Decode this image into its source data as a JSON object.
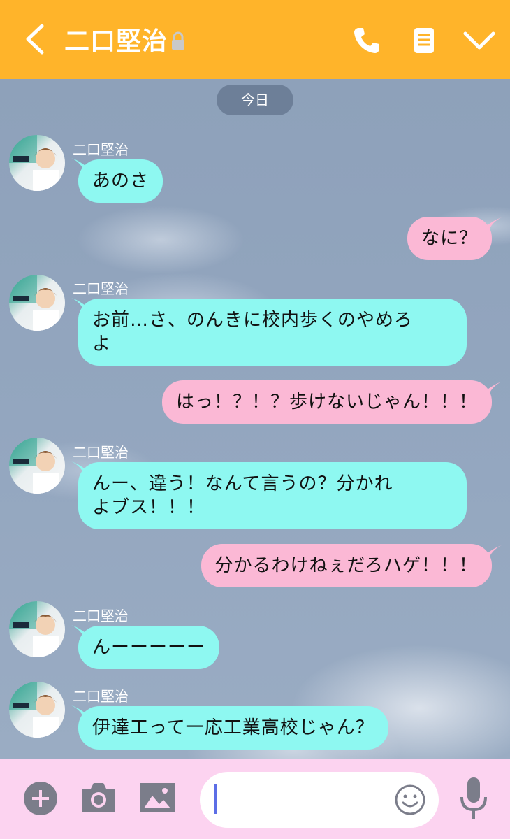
{
  "header": {
    "title": "二口堅治",
    "back_icon": "chevron-left-icon",
    "lock_icon": "lock-icon",
    "call_icon": "phone-icon",
    "notes_icon": "notes-icon",
    "menu_icon": "chevron-down-icon",
    "color": "#ffb42a"
  },
  "chat": {
    "date_label": "今日",
    "messages": [
      {
        "side": "in",
        "sender": "二口堅治",
        "text": "あのさ"
      },
      {
        "side": "out",
        "text": "なに？"
      },
      {
        "side": "in",
        "sender": "二口堅治",
        "lines": [
          "お前…さ、のんきに校内歩くのやめろ",
          "よ"
        ]
      },
      {
        "side": "out",
        "text": "はっ！？！？歩けないじゃん！！！"
      },
      {
        "side": "in",
        "sender": "二口堅治",
        "lines": [
          "んー、違う！なんて言うの？分かれ",
          "よブス！！！"
        ]
      },
      {
        "side": "out",
        "text": "分かるわけねぇだろハゲ！！！"
      },
      {
        "side": "in",
        "sender": "二口堅治",
        "text": "んーーーーー"
      },
      {
        "side": "in",
        "sender": "二口堅治",
        "text": "伊達工って一応工業高校じゃん？"
      }
    ],
    "incoming_color": "#8ef8f1",
    "outgoing_color": "#fbb8d5"
  },
  "footer": {
    "input_value": "",
    "plus_icon": "plus-circle-icon",
    "camera_icon": "camera-icon",
    "image_icon": "image-icon",
    "emoji_icon": "smiley-icon",
    "mic_icon": "microphone-icon",
    "color": "#fcd3f0"
  }
}
